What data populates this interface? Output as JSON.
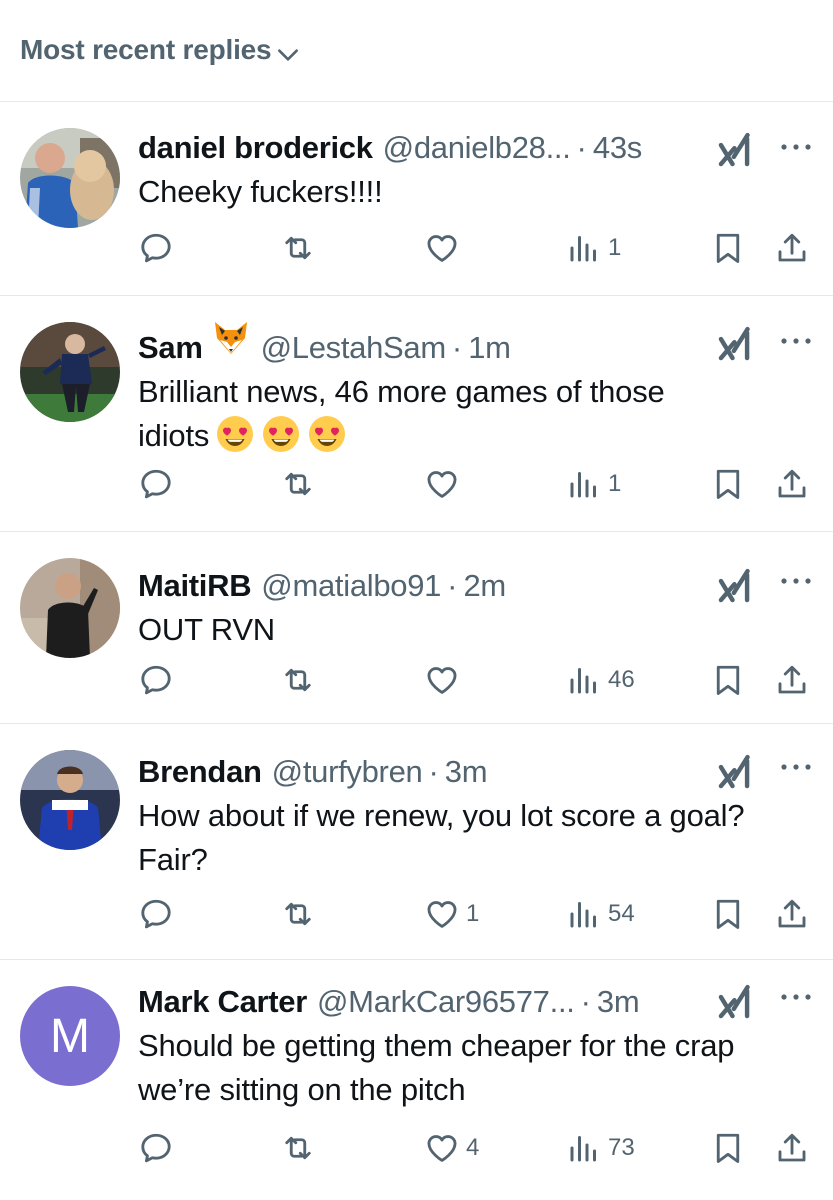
{
  "sort": {
    "label": "Most recent replies",
    "icon": "chevron-down-icon"
  },
  "colors": {
    "secondary_text": "#536471",
    "primary_text": "#0f1419",
    "divider": "#e6e9ec",
    "avatar_m_bg": "#7a6fd1"
  },
  "replies": [
    {
      "display_name": "daniel broderick",
      "handle": "@danielb28...",
      "time": "43s",
      "text": "Cheeky fuckers!!!!",
      "likes": "",
      "views": "1",
      "avatar": "photo"
    },
    {
      "display_name": "Sam",
      "name_emoji": "fox-emoji",
      "handle": "@LestahSam",
      "time": "1m",
      "text_line1": "Brilliant news, 46 more games of those",
      "text_line2": "idiots",
      "text_emojis": [
        "heart-eyes-emoji",
        "heart-eyes-emoji",
        "heart-eyes-emoji"
      ],
      "likes": "",
      "views": "1",
      "avatar": "photo"
    },
    {
      "display_name": "MaitiRB",
      "handle": "@matialbo91",
      "time": "2m",
      "text": "OUT RVN",
      "likes": "",
      "views": "46",
      "avatar": "photo"
    },
    {
      "display_name": "Brendan",
      "handle": "@turfybren",
      "time": "3m",
      "text_line1": "How about if we renew, you lot score a goal?",
      "text_line2": "Fair?",
      "likes": "1",
      "views": "54",
      "avatar": "photo"
    },
    {
      "display_name": "Mark Carter",
      "handle": "@MarkCar96577...",
      "time": "3m",
      "text_line1": "Should be getting them cheaper for the crap",
      "text_line2": "we’re sitting on the pitch",
      "likes": "4",
      "views": "73",
      "avatar_letter": "M"
    }
  ]
}
